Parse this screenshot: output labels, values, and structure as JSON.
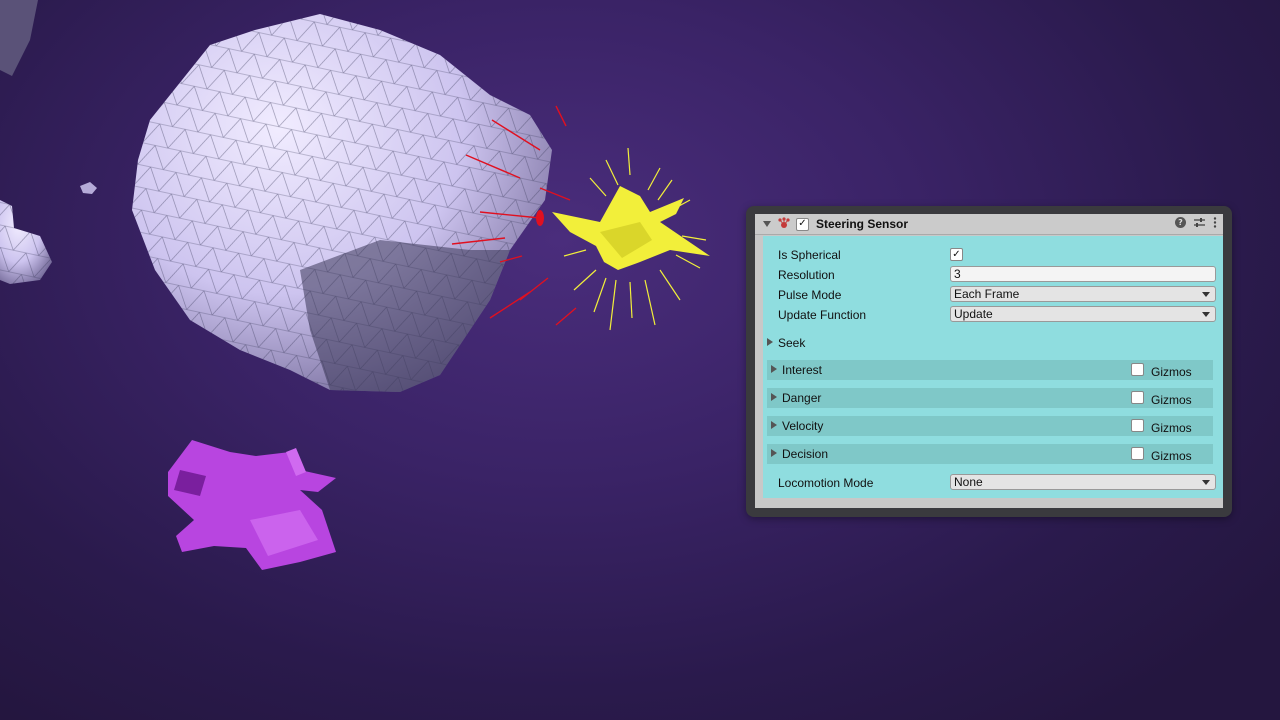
{
  "component": {
    "title": "Steering Sensor",
    "enabled_check": "✓",
    "icon": "steering-sensor-icon",
    "help_icon": "?"
  },
  "fields": {
    "is_spherical": {
      "label": "Is Spherical",
      "check": "✓"
    },
    "resolution": {
      "label": "Resolution",
      "value": "3"
    },
    "pulse_mode": {
      "label": "Pulse Mode",
      "value": "Each Frame"
    },
    "update_function": {
      "label": "Update Function",
      "value": "Update"
    },
    "locomotion_mode": {
      "label": "Locomotion Mode",
      "value": "None"
    }
  },
  "foldouts": {
    "seek": "Seek",
    "interest": "Interest",
    "danger": "Danger",
    "velocity": "Velocity",
    "decision": "Decision",
    "gizmos_label": "Gizmos"
  },
  "colors": {
    "background": "#2a1a4c",
    "asteroid": "#d8d0f4",
    "yellow_ship": "#f2ef3a",
    "magenta_ship": "#b845e0",
    "danger_rays": "#e01020",
    "inspector_body": "#8fdddf"
  }
}
